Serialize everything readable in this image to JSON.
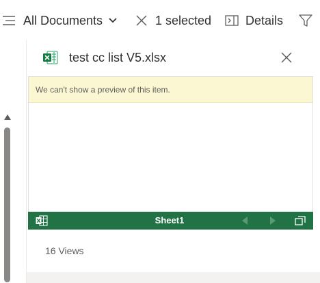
{
  "commandbar": {
    "view_label": "All Documents",
    "selection_label": "1 selected",
    "details_label": "Details",
    "icons": [
      "list-view-icon",
      "chevron-down-icon",
      "clear-selection-icon",
      "details-pane-icon",
      "filter-icon"
    ]
  },
  "panel": {
    "file_name": "test cc list V5.xlsx",
    "file_icon": "excel-file-icon",
    "preview_notice": "We can't show a preview of this item.",
    "viewer": {
      "sheet_tab": "Sheet1"
    },
    "views_text": "16 Views"
  },
  "colors": {
    "excel_green": "#217346",
    "notice_bg": "#fbf7d2",
    "text_primary": "#323130",
    "text_secondary": "#605e5c"
  }
}
